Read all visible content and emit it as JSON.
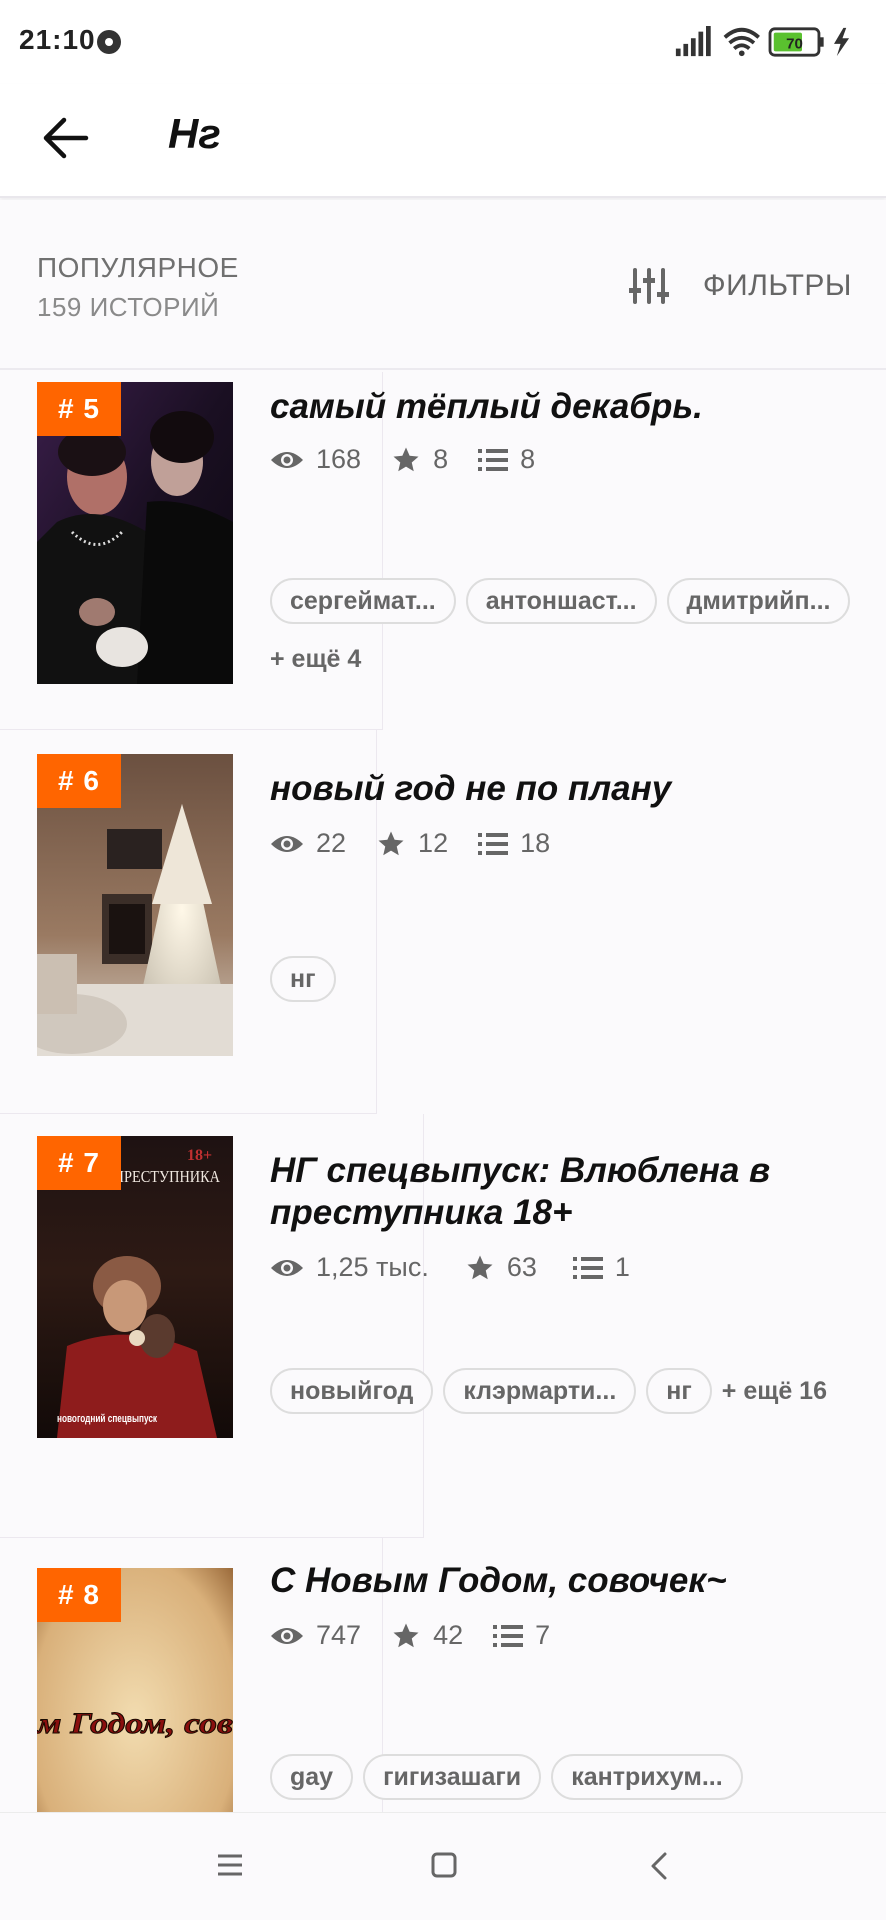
{
  "status_bar": {
    "time": "21:10",
    "battery": "70"
  },
  "header": {
    "title": "Нг"
  },
  "sort": {
    "title": "ПОПУЛЯРНОЕ",
    "count": "159 ИСТОРИЙ",
    "filter_label": "ФИЛЬТРЫ"
  },
  "stories": [
    {
      "rank": "# 5",
      "title": "самый тёплый декабрь.",
      "views": "168",
      "votes": "8",
      "parts": "8",
      "tags": [
        "сергеймат...",
        "антоншаст...",
        "дмитрийп..."
      ],
      "more": "+ ещё 4"
    },
    {
      "rank": "# 6",
      "title": "новый год не по плану",
      "views": "22",
      "votes": "12",
      "parts": "18",
      "tags": [
        "нг"
      ],
      "more": ""
    },
    {
      "rank": "# 7",
      "title": "НГ спецвыпуск: Влюблена в преступника 18+",
      "views": "1,25 тыс.",
      "votes": "63",
      "parts": "1",
      "tags": [
        "новыйгод",
        "клэрмарти...",
        "нг"
      ],
      "more": "+ ещё 16",
      "cover_text": {
        "top": "18+",
        "title": "БЛЕНА В ПРЕСТУПНИКА",
        "bottom": "новогодний спецвыпуск"
      }
    },
    {
      "rank": "# 8",
      "title": "С Новым Годом, совочек~",
      "views": "747",
      "votes": "42",
      "parts": "7",
      "tags": [
        "gay",
        "гигизашаги",
        "кантрихум..."
      ],
      "more": "",
      "cover_text": {
        "banner": "м Годом, сов"
      }
    }
  ],
  "colors": {
    "accent": "#ff6500",
    "text": "#111111",
    "muted": "#666666"
  }
}
